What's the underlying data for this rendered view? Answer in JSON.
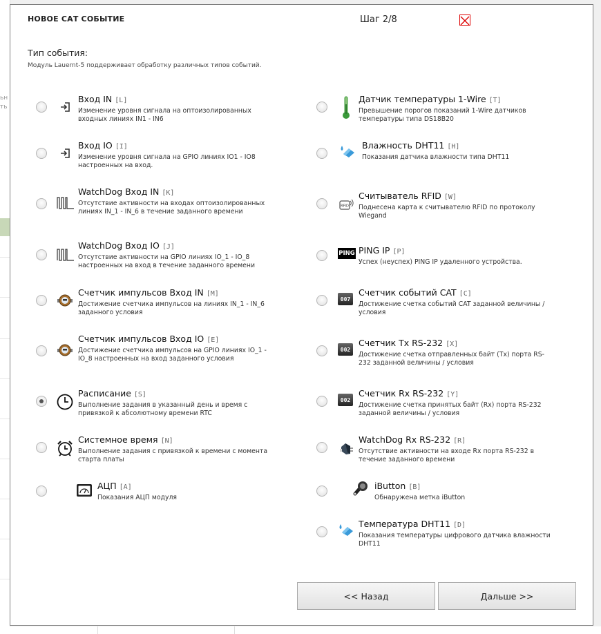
{
  "background": {
    "fragment_1": "ьн",
    "fragment_2": "ть"
  },
  "dialog": {
    "title": "НОВОЕ САТ СОБЫТИЕ",
    "step": "Шаг 2/8",
    "heading": "Тип события:",
    "subheading": "Модуль Lauernt-5 поддерживает обработку различных типов событий.",
    "selected_event": "Расписание"
  },
  "left_events": [
    {
      "label": "Вход IN",
      "code": "[L]",
      "icon": "input-arrow-icon",
      "desc": "Изменение уровня сигнала на оптоизолированных входных линиях IN1 - IN6"
    },
    {
      "label": "Вход IO",
      "code": "[I]",
      "icon": "input-arrow-icon",
      "desc": "Изменение уровня сигнала на GPIO линиях IO1 - IO8 настроенных на вход."
    },
    {
      "label": "WatchDog Вход IN",
      "code": "[K]",
      "icon": "watchdog-pulse-icon",
      "desc": "Отсутствие активности на входах оптоизолированных линиях IN_1 - IN_6 в течение заданного времени"
    },
    {
      "label": "WatchDog Вход IO",
      "code": "[J]",
      "icon": "watchdog-pulse-icon",
      "desc": "Отсутствие активности на GPIO линиях IO_1 - IO_8 настроенных на вход в течение заданного времени"
    },
    {
      "label": "Счетчик импульсов Вход IN",
      "code": "[M]",
      "icon": "water-meter-icon",
      "desc": "Достижение счетчика импульсов на линиях IN_1 - IN_6 заданного условия"
    },
    {
      "label": "Счетчик импульсов Вход IO",
      "code": "[E]",
      "icon": "water-meter-icon",
      "desc": "Достижение счетчика импульсов на GPIO линиях IO_1 - IO_8 настроенных на вход заданного условия"
    },
    {
      "label": "Расписание",
      "code": "[S]",
      "icon": "clock-icon",
      "desc": "Выполнение задания в указанный день и время с привязкой к абсолютному времени RTC"
    },
    {
      "label": "Системное время",
      "code": "[N]",
      "icon": "alarm-clock-icon",
      "desc": "Выполнение задания с привязкой к времени с момента старта платы"
    },
    {
      "label": "АЦП",
      "code": "[A]",
      "icon": "gauge-icon",
      "desc": "Показания АЦП модуля"
    }
  ],
  "right_events": [
    {
      "label": "Датчик температуры 1-Wire",
      "code": "[T]",
      "icon": "thermometer-icon",
      "desc": "Превышение порогов показаний 1-Wire датчиков температуры типа DS18B20"
    },
    {
      "label": "Влажность DHT11",
      "code": "[H]",
      "icon": "humidity-drop-icon",
      "desc": "Показания датчика влажности типа DHT11"
    },
    {
      "label": "Считыватель RFID",
      "code": "[W]",
      "icon": "rfid-icon",
      "desc": "Поднесена карта к считывателю RFID по протоколу Wiegand"
    },
    {
      "label": "PING IP",
      "code": "[P]",
      "icon": "ping-icon",
      "icon_text": "PING",
      "desc": "Успех (неуспех) PING IP удаленного устройства."
    },
    {
      "label": "Счетчик событий CAT",
      "code": "[C]",
      "icon": "counter-icon",
      "icon_text": "007",
      "desc": "Достижение счетка событий CAT заданной величины / условия"
    },
    {
      "label": "Счетчик Tx RS-232",
      "code": "[X]",
      "icon": "counter-icon",
      "icon_text": "002",
      "desc": "Достижение счетка отправленных байт (Tx) порта RS-232 заданной величины / условия"
    },
    {
      "label": "Счетчик Rx RS-232",
      "code": "[Y]",
      "icon": "counter-icon",
      "icon_text": "002",
      "desc": "Достижение счетка принятых байт (Rx) порта RS-232 заданной величины / условия"
    },
    {
      "label": "WatchDog Rx RS-232",
      "code": "[R]",
      "icon": "serial-plug-icon",
      "desc": "Отсутствие активности на входе Rx порта RS-232 в течение заданного времени"
    },
    {
      "label": "iButton",
      "code": "[B]",
      "icon": "ibutton-key-icon",
      "desc": "Обнаружена метка iButton"
    },
    {
      "label": "Температура DHT11",
      "code": "[D]",
      "icon": "humidity-drop-icon",
      "desc": "Показания температуры цифрового датчика влажности DHT11"
    }
  ],
  "buttons": {
    "back": "<< Назад",
    "next": "Дальше >>"
  },
  "colors": {
    "close_red": "#dd0000",
    "drop_blue": "#3a9ad9",
    "thermo_green": "#3a9a3a"
  }
}
